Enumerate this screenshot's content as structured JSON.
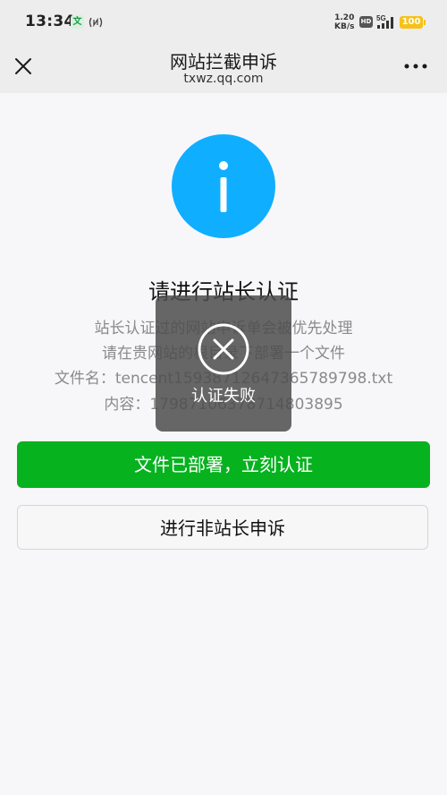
{
  "status_bar": {
    "time": "13:34",
    "input_badge": "文",
    "speed_value": "1.20",
    "speed_unit": "KB/s",
    "hd_label": "HD",
    "network_label": "5G",
    "battery": "100",
    "icons": [
      "nfc-icon",
      "hd-icon",
      "signal-icon",
      "battery-icon"
    ]
  },
  "nav": {
    "title": "网站拦截申诉",
    "subtitle": "txwz.qq.com",
    "close_icon": "close-icon",
    "more_icon": "more-icon"
  },
  "main": {
    "status_icon": "info-icon",
    "heading": "请进行站长认证",
    "lines": [
      "站长认证过的网站申诉单会被优先处理",
      "请在贵网站的根目录下部署一个文件",
      "文件名：tencent15938712647365789798.txt",
      "内容：17987106378714803895"
    ],
    "primary_button": "文件已部署，立刻认证",
    "secondary_button": "进行非站长申诉"
  },
  "toast": {
    "icon": "error-circle-icon",
    "message": "认证失败"
  },
  "colors": {
    "accent_green": "#07b21f",
    "info_blue": "#10aeff",
    "bar_background": "#ededed",
    "page_background": "#f7f7fa"
  }
}
